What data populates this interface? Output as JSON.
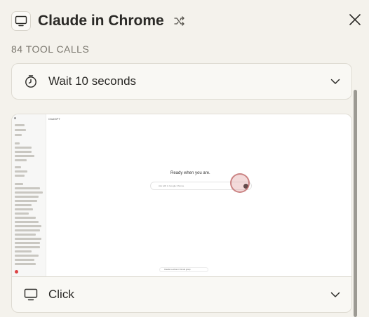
{
  "header": {
    "title": "Claude in Chrome",
    "app_icon": "monitor-icon",
    "shuffle_icon": "shuffle-icon",
    "close_icon": "close-icon"
  },
  "tool_calls_label": "84 TOOL CALLS",
  "steps": [
    {
      "label": "Wait 10 seconds",
      "icon": "timer-icon"
    },
    {
      "label": "Click",
      "icon": "monitor-icon"
    }
  ],
  "screenshot": {
    "top_bar": "ChatGPT",
    "greeting": "Ready when you are.",
    "input_placeholder": "Ask with in Google Chrome",
    "toast": "Claude is active in this tab group"
  },
  "colors": {
    "background": "#f4f2ec",
    "card": "#f9f8f4",
    "border": "#dedbd2",
    "click_marker": "#b95f5f"
  }
}
